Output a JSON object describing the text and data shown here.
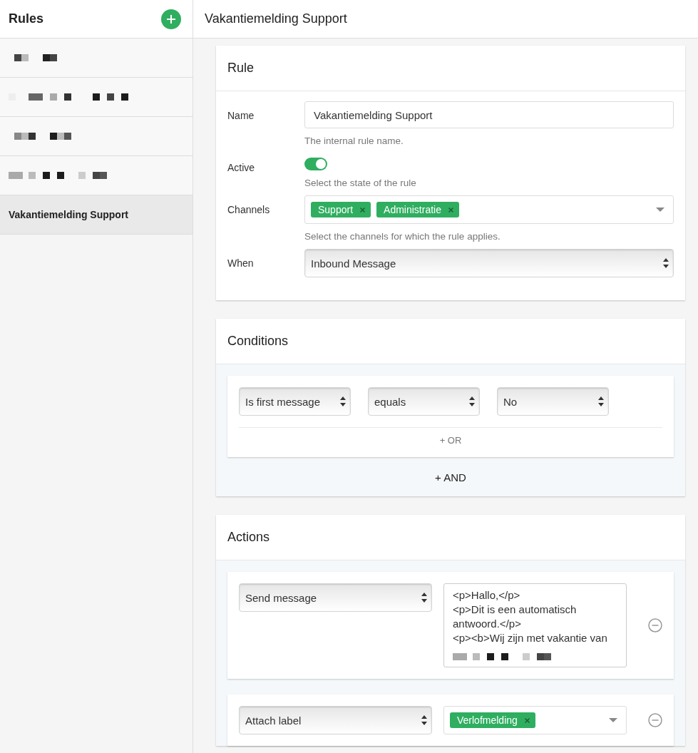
{
  "sidebar": {
    "title": "Rules",
    "items": [
      {
        "redacted": true,
        "selected": false
      },
      {
        "redacted": true,
        "selected": false
      },
      {
        "redacted": true,
        "selected": false
      },
      {
        "redacted": true,
        "selected": false
      },
      {
        "label": "Vakantiemelding Support",
        "selected": true
      }
    ]
  },
  "header": {
    "title": "Vakantiemelding Support"
  },
  "rule": {
    "title": "Rule",
    "fields": [
      {
        "kind": "text",
        "label": "Name",
        "value": "Vakantiemelding Support",
        "help": "The internal rule name."
      },
      {
        "kind": "toggle",
        "label": "Active",
        "on": true,
        "help": "Select the state of the rule"
      },
      {
        "kind": "tags",
        "label": "Channels",
        "tags": [
          "Support",
          "Administratie"
        ],
        "help": "Select the channels for which the rule applies."
      },
      {
        "kind": "select",
        "label": "When",
        "value": "Inbound Message"
      }
    ]
  },
  "conditions": {
    "title": "Conditions",
    "groups": [
      {
        "selects": [
          "Is first message",
          "equals",
          "No"
        ],
        "or_label": "+ OR"
      }
    ],
    "and_label": "+ AND"
  },
  "actions": {
    "title": "Actions",
    "items": [
      {
        "kind": "message",
        "action": "Send message",
        "text": "<p>Hallo,</p>\n<p>Dit is een automatisch antwoord.</p>\n<p><b>Wij zijn met vakantie van"
      },
      {
        "kind": "label",
        "action": "Attach label",
        "tags": [
          "Verlofmelding"
        ]
      }
    ]
  }
}
